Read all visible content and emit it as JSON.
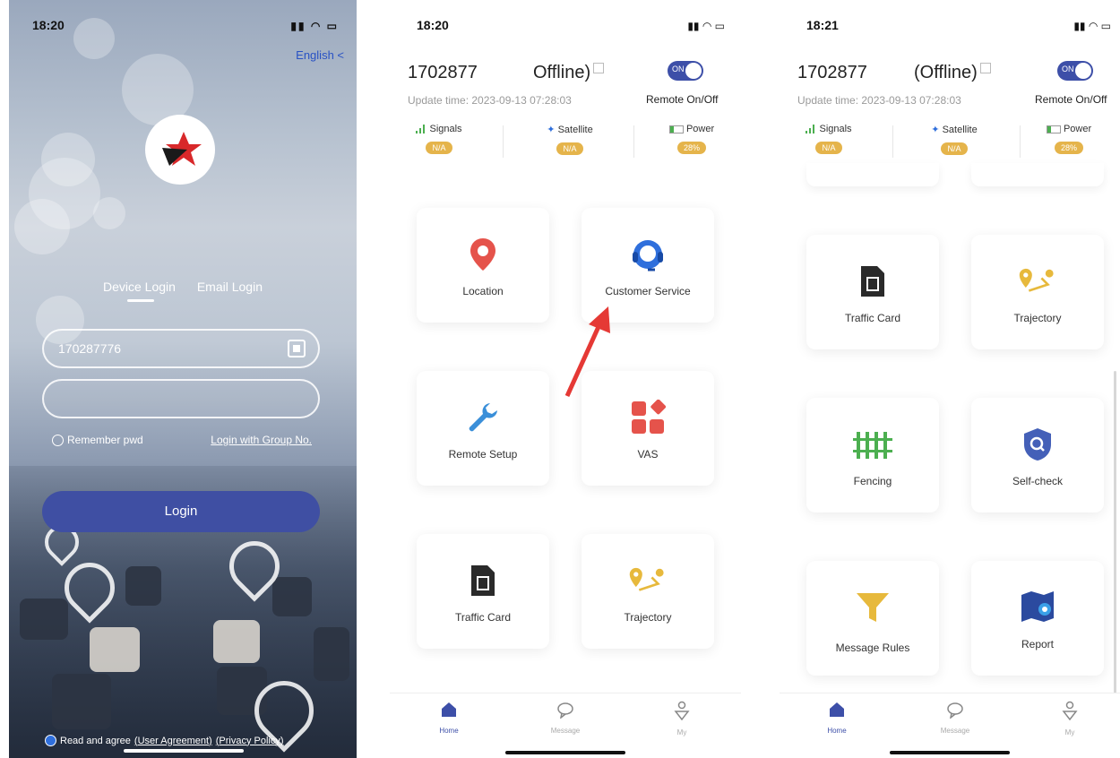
{
  "login": {
    "time": "18:20",
    "language": "English <",
    "tabs": {
      "device": "Device Login",
      "email": "Email Login"
    },
    "device_id_value": "170287776",
    "password_value": "",
    "remember": "Remember pwd",
    "group_link": "Login with Group No.",
    "login_button": "Login",
    "agree_text": "Read and agree",
    "user_agreement": "(User Agreement)",
    "privacy_policy": "(Privacy Policy)"
  },
  "home1": {
    "time": "18:20",
    "device_id": "1702877",
    "status": "Offline)",
    "update_time": "Update time: 2023-09-13 07:28:03",
    "toggle_label": "ON",
    "remote_label": "Remote On/Off",
    "metrics": [
      {
        "label": "Signals",
        "value": "N/A"
      },
      {
        "label": "Satellite",
        "value": "N/A"
      },
      {
        "label": "Power",
        "value": "28%"
      }
    ],
    "cards": [
      {
        "label": "Location",
        "icon": "location-pin-icon"
      },
      {
        "label": "Customer Service",
        "icon": "headset-icon"
      },
      {
        "label": "Remote Setup",
        "icon": "wrench-icon"
      },
      {
        "label": "VAS",
        "icon": "apps-icon"
      },
      {
        "label": "Traffic Card",
        "icon": "sim-card-icon"
      },
      {
        "label": "Trajectory",
        "icon": "route-icon"
      }
    ],
    "nav": [
      {
        "label": "Home"
      },
      {
        "label": "Message"
      },
      {
        "label": "My"
      }
    ]
  },
  "home2": {
    "time": "18:21",
    "device_id": "1702877",
    "status": "(Offline)",
    "update_time": "Update time: 2023-09-13 07:28:03",
    "toggle_label": "ON",
    "remote_label": "Remote On/Off",
    "metrics": [
      {
        "label": "Signals",
        "value": "N/A"
      },
      {
        "label": "Satellite",
        "value": "N/A"
      },
      {
        "label": "Power",
        "value": "28%"
      }
    ],
    "cards": [
      {
        "label": "Traffic Card",
        "icon": "sim-card-icon"
      },
      {
        "label": "Trajectory",
        "icon": "route-icon"
      },
      {
        "label": "Fencing",
        "icon": "fence-icon"
      },
      {
        "label": "Self-check",
        "icon": "shield-search-icon"
      },
      {
        "label": "Message Rules",
        "icon": "funnel-icon"
      },
      {
        "label": "Report",
        "icon": "map-report-icon"
      }
    ],
    "nav": [
      {
        "label": "Home"
      },
      {
        "label": "Message"
      },
      {
        "label": "My"
      }
    ]
  },
  "colors": {
    "accent": "#3d4fa8",
    "badge": "#e5b44b",
    "location": "#e5534b",
    "service": "#2f6fdc",
    "gold": "#e7b93c"
  }
}
